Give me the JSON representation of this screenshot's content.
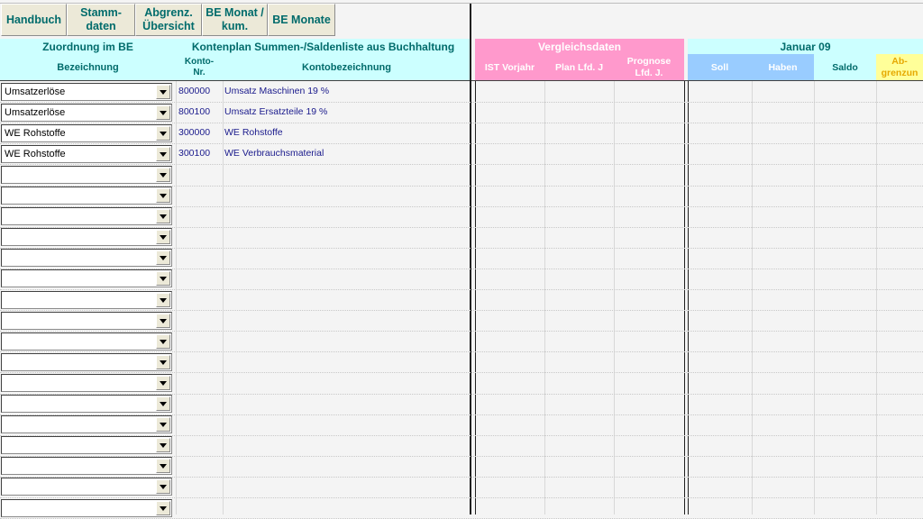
{
  "toolbar": {
    "handbuch": "Handbuch",
    "stammdaten": "Stamm-\ndaten",
    "abgrenz": "Abgrenz.\nÜbersicht",
    "be_monat": "BE Monat /\nkum.",
    "be_monate": "BE Monate"
  },
  "headers": {
    "zuordnung": "Zuordnung im BE",
    "bezeichnung": "Bezeichnung",
    "kontenplan": "Kontenplan Summen-/Saldenliste aus Buchhaltung",
    "konto_nr": "Konto-\nNr.",
    "kontobezeichnung": "Kontobezeichnung",
    "vergleichsdaten": "Vergleichsdaten",
    "ist_vorjahr": "IST Vorjahr",
    "plan_lfd": "Plan Lfd. J",
    "prognose": "Prognose\nLfd. J.",
    "januar": "Januar 09",
    "soll": "Soll",
    "haben": "Haben",
    "saldo": "Saldo",
    "abgrenzung": "Ab-\ngrenzun"
  },
  "rows": [
    {
      "zuordnung": "Umsatzerlöse",
      "konto_nr": "800000",
      "kontobezeichnung": "Umsatz Maschinen 19 %"
    },
    {
      "zuordnung": "Umsatzerlöse",
      "konto_nr": "800100",
      "kontobezeichnung": "Umsatz Ersatzteile 19 %"
    },
    {
      "zuordnung": "WE Rohstoffe",
      "konto_nr": "300000",
      "kontobezeichnung": "WE Rohstoffe"
    },
    {
      "zuordnung": "WE Rohstoffe",
      "konto_nr": "300100",
      "kontobezeichnung": "WE Verbrauchsmaterial"
    },
    {
      "zuordnung": "",
      "konto_nr": "",
      "kontobezeichnung": ""
    },
    {
      "zuordnung": "",
      "konto_nr": "",
      "kontobezeichnung": ""
    },
    {
      "zuordnung": "",
      "konto_nr": "",
      "kontobezeichnung": ""
    },
    {
      "zuordnung": "",
      "konto_nr": "",
      "kontobezeichnung": ""
    },
    {
      "zuordnung": "",
      "konto_nr": "",
      "kontobezeichnung": ""
    },
    {
      "zuordnung": "",
      "konto_nr": "",
      "kontobezeichnung": ""
    },
    {
      "zuordnung": "",
      "konto_nr": "",
      "kontobezeichnung": ""
    },
    {
      "zuordnung": "",
      "konto_nr": "",
      "kontobezeichnung": ""
    },
    {
      "zuordnung": "",
      "konto_nr": "",
      "kontobezeichnung": ""
    },
    {
      "zuordnung": "",
      "konto_nr": "",
      "kontobezeichnung": ""
    },
    {
      "zuordnung": "",
      "konto_nr": "",
      "kontobezeichnung": ""
    },
    {
      "zuordnung": "",
      "konto_nr": "",
      "kontobezeichnung": ""
    },
    {
      "zuordnung": "",
      "konto_nr": "",
      "kontobezeichnung": ""
    },
    {
      "zuordnung": "",
      "konto_nr": "",
      "kontobezeichnung": ""
    },
    {
      "zuordnung": "",
      "konto_nr": "",
      "kontobezeichnung": ""
    },
    {
      "zuordnung": "",
      "konto_nr": "",
      "kontobezeichnung": ""
    },
    {
      "zuordnung": "",
      "konto_nr": "",
      "kontobezeichnung": ""
    }
  ],
  "icons": {
    "dropdown": "chevron-down-icon"
  },
  "colors": {
    "cyan": "#ccffff",
    "pink": "#ff99cc",
    "blue": "#99ccff",
    "yellow": "#ffff99",
    "teal_text": "#006b6b"
  }
}
